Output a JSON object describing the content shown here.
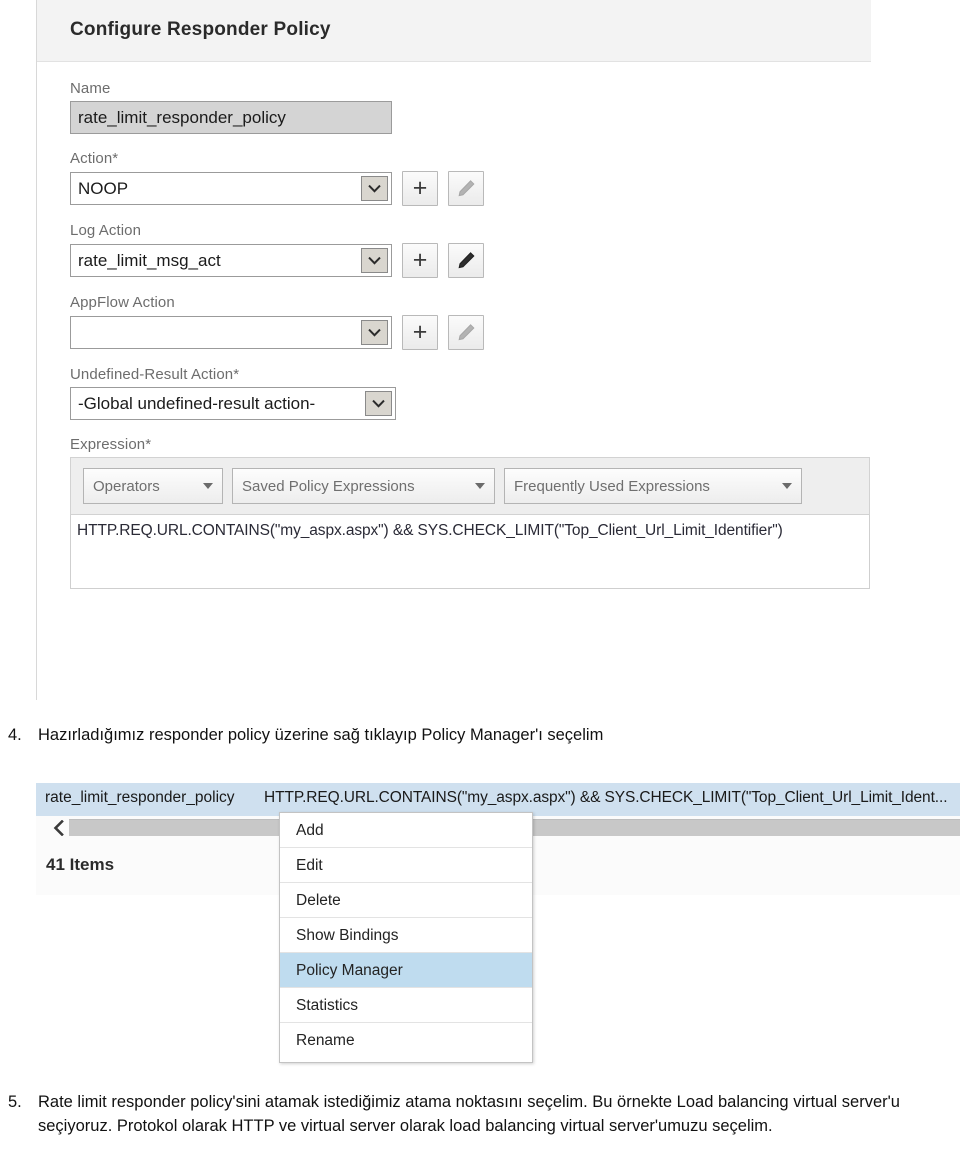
{
  "document": {
    "steps": [
      {
        "number": "4.",
        "text": "Hazırladığımız responder policy üzerine sağ tıklayıp Policy Manager'ı seçelim"
      },
      {
        "number": "5.",
        "text": "Rate limit responder policy'sini atamak istediğimiz atama noktasını seçelim. Bu örnekte Load balancing virtual server'u seçiyoruz. Protokol olarak HTTP ve virtual server olarak load balancing virtual server'umuzu seçelim."
      }
    ]
  },
  "configure_panel": {
    "title": "Configure Responder Policy",
    "fields": {
      "name": {
        "label": "Name",
        "value": "rate_limit_responder_policy"
      },
      "action": {
        "label": "Action*",
        "value": "NOOP",
        "add_label": "+",
        "edit_icon": "pencil-icon",
        "edit_enabled": false
      },
      "log_action": {
        "label": "Log Action",
        "value": "rate_limit_msg_act",
        "add_label": "+",
        "edit_icon": "pencil-icon",
        "edit_enabled": true
      },
      "appflow_action": {
        "label": "AppFlow Action",
        "value": "",
        "add_label": "+",
        "edit_icon": "pencil-icon",
        "edit_enabled": false
      },
      "undefined_result_action": {
        "label": "Undefined-Result Action*",
        "value": "-Global undefined-result action-"
      },
      "expression": {
        "label": "Expression*",
        "operators_label": "Operators",
        "saved_label": "Saved Policy Expressions",
        "frequently_used_label": "Frequently Used Expressions",
        "value": "HTTP.REQ.URL.CONTAINS(\"my_aspx.aspx\") && SYS.CHECK_LIMIT(\"Top_Client_Url_Limit_Identifier\")"
      }
    }
  },
  "policy_list": {
    "selected_row": {
      "name": "rate_limit_responder_policy",
      "expression": "HTTP.REQ.URL.CONTAINS(\"my_aspx.aspx\") && SYS.CHECK_LIMIT(\"Top_Client_Url_Limit_Ident..."
    },
    "items_count": "41 Items",
    "back_icon": "chevron-left-icon"
  },
  "context_menu": {
    "items": [
      {
        "label": "Add",
        "selected": false
      },
      {
        "label": "Edit",
        "selected": false
      },
      {
        "label": "Delete",
        "selected": false
      },
      {
        "label": "Show Bindings",
        "selected": false
      },
      {
        "label": "Policy Manager",
        "selected": true
      },
      {
        "label": "Statistics",
        "selected": false
      },
      {
        "label": "Rename",
        "selected": false
      }
    ]
  },
  "colors": {
    "selection_blue": "#bfdcef",
    "row_highlight": "#cfe0ef",
    "panel_header": "#f3f3f3",
    "input_filled": "#d4d4d4"
  }
}
